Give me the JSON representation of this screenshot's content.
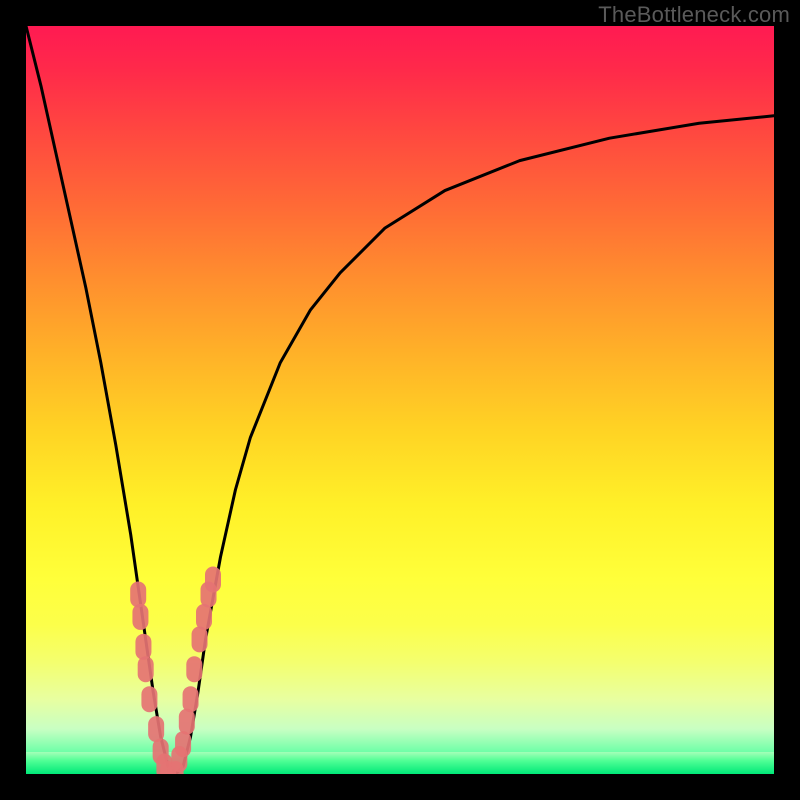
{
  "watermark": "TheBottleneck.com",
  "colors": {
    "frame": "#000000",
    "curve": "#000000",
    "marker_fill": "#e57373",
    "gradient_top": "#ff1a52",
    "gradient_bottom": "#00e878"
  },
  "chart_data": {
    "type": "line",
    "title": "",
    "xlabel": "",
    "ylabel": "",
    "xlim": [
      0,
      100
    ],
    "ylim": [
      0,
      100
    ],
    "grid": false,
    "legend": false,
    "series": [
      {
        "name": "bottleneck-curve",
        "style": "line",
        "x": [
          0,
          2,
          4,
          6,
          8,
          10,
          12,
          13,
          14,
          15,
          16,
          17,
          18,
          19,
          20,
          21,
          22,
          23,
          24,
          26,
          28,
          30,
          34,
          38,
          42,
          48,
          56,
          66,
          78,
          90,
          100
        ],
        "y": [
          100,
          92,
          83,
          74,
          65,
          55,
          44,
          38,
          32,
          25,
          18,
          11,
          5,
          1,
          0,
          1,
          5,
          11,
          18,
          29,
          38,
          45,
          55,
          62,
          67,
          73,
          78,
          82,
          85,
          87,
          88
        ]
      },
      {
        "name": "data-points-left",
        "style": "markers",
        "x": [
          15.0,
          15.3,
          15.7,
          16.0,
          16.5,
          17.4,
          18.0,
          18.5,
          19.0
        ],
        "y": [
          24,
          21,
          17,
          14,
          10,
          6,
          3,
          1,
          0
        ]
      },
      {
        "name": "data-points-right",
        "style": "markers",
        "x": [
          20.0,
          20.5,
          21.0,
          21.5,
          22.0,
          22.5,
          23.2,
          23.8,
          24.4,
          25.0
        ],
        "y": [
          0,
          2,
          4,
          7,
          10,
          14,
          18,
          21,
          24,
          26
        ]
      }
    ]
  }
}
